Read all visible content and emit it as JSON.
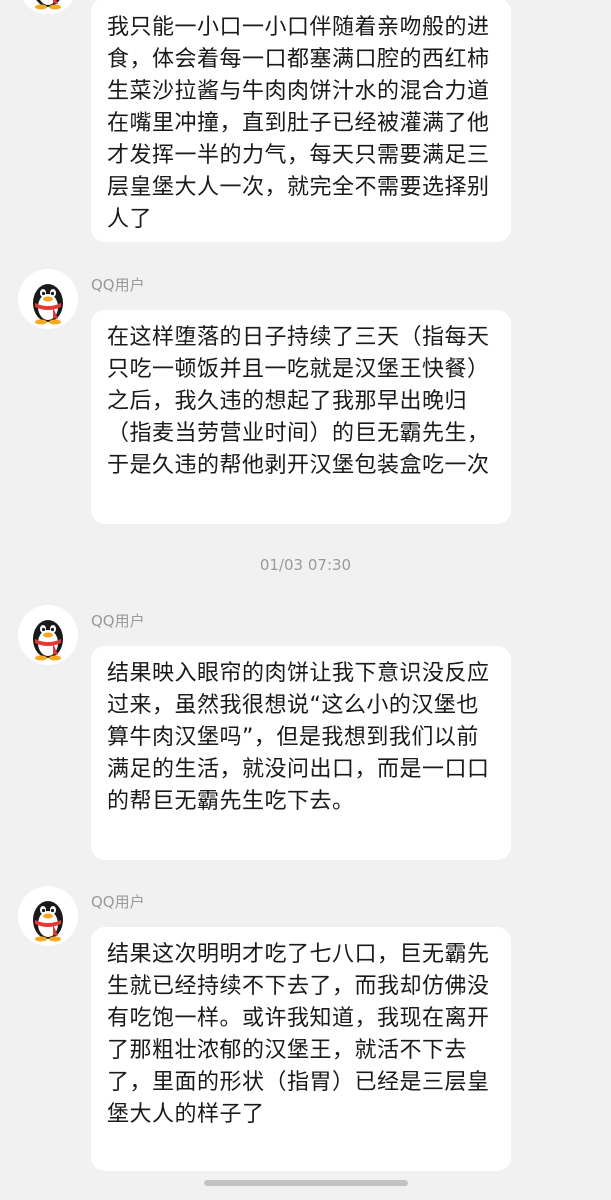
{
  "messages": [
    {
      "sender": "",
      "text": "我只能一小口一小口伴随着亲吻般的进食，体会着每一口都塞满口腔的西红柿生菜沙拉酱与牛肉肉饼汁水的混合力道在嘴里冲撞，直到肚子已经被灌满了他才发挥一半的力气，每天只需要满足三层皇堡大人一次，就完全不需要选择别人了"
    },
    {
      "sender": "QQ用户",
      "text": "在这样堕落的日子持续了三天（指每天只吃一顿饭并且一吃就是汉堡王快餐）之后，我久违的想起了我那早出晚归（指麦当劳营业时间）的巨无霸先生，于是久违的帮他剥开汉堡包装盒吃一次"
    },
    {
      "sender": "QQ用户",
      "text": "结果映入眼帘的肉饼让我下意识没反应过来，虽然我很想说“这么小的汉堡也算牛肉汉堡吗”，但是我想到我们以前满足的生活，就没问出口，而是一口口的帮巨无霸先生吃下去。"
    },
    {
      "sender": "QQ用户",
      "text": "结果这次明明才吃了七八口，巨无霸先生就已经持续不下去了，而我却仿佛没有吃饱一样。或许我知道，我现在离开了那粗壮浓郁的汉堡王，就活不下去了，里面的形状（指胃）已经是三层皇堡大人的样子了"
    }
  ],
  "timestamp": "01/03 07:30",
  "avatar_icon": "qq-penguin-icon",
  "colors": {
    "background": "#f1f1f1",
    "bubble": "#ffffff",
    "text": "#1a1a1a",
    "meta": "#9a9a9a",
    "scarf": "#e53935"
  }
}
